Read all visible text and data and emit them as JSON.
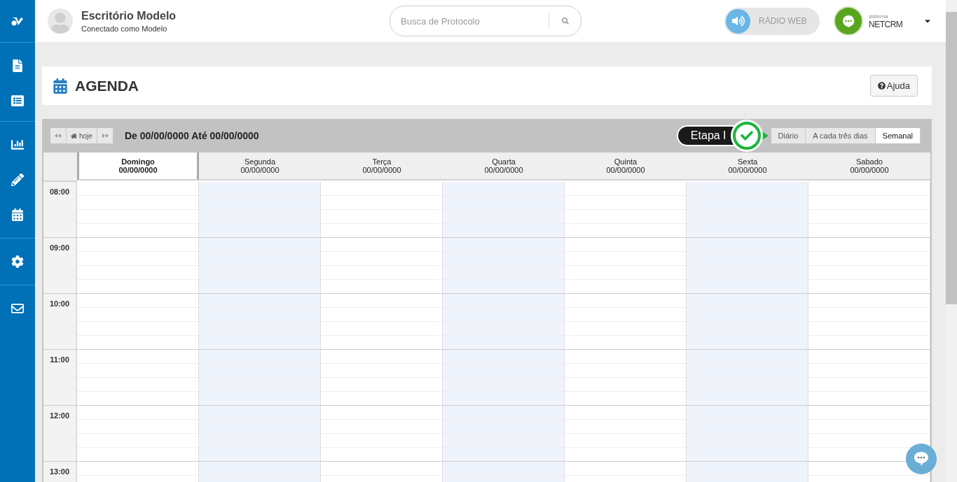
{
  "header": {
    "office": "Escritório Modelo",
    "connected": "Conectado como Modelo",
    "search": {
      "placeholder": "Busca de Protocolo"
    },
    "radio": {
      "label": "RÁDIO WEB",
      "on": false
    },
    "brand": {
      "small": "sistema",
      "name": "NETCRM"
    }
  },
  "page": {
    "title": "AGENDA",
    "help": "Ajuda"
  },
  "toolbar": {
    "today": "hoje",
    "range": "De 00/00/0000 Até 00/00/0000",
    "step_badge": "Etapa I",
    "views": [
      {
        "label": "Diário",
        "selected": false
      },
      {
        "label": "A cada três dias",
        "selected": false
      },
      {
        "label": "Semanal",
        "selected": true
      }
    ]
  },
  "days": [
    {
      "name": "Domingo",
      "date": "00/00/0000",
      "selected": true
    },
    {
      "name": "Segunda",
      "date": "00/00/0000",
      "selected": false
    },
    {
      "name": "Terça",
      "date": "00/00/0000",
      "selected": false
    },
    {
      "name": "Quarta",
      "date": "00/00/0000",
      "selected": false
    },
    {
      "name": "Quinta",
      "date": "00/00/0000",
      "selected": false
    },
    {
      "name": "Sexta",
      "date": "00/00/0000",
      "selected": false
    },
    {
      "name": "Sabado",
      "date": "00/00/0000",
      "selected": false
    }
  ],
  "hours": [
    "08:00",
    "09:00",
    "10:00",
    "11:00",
    "12:00",
    "13:00"
  ]
}
